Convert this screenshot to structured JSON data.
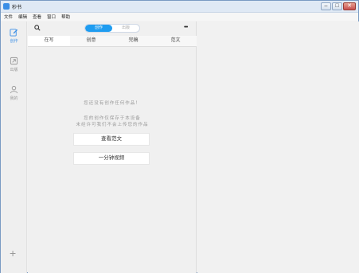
{
  "window": {
    "title": "秒书"
  },
  "menubar": {
    "items": [
      "文件",
      "编辑",
      "查看",
      "窗口",
      "帮助"
    ]
  },
  "sidebar": {
    "items": [
      {
        "label": "创作",
        "icon": "pencil-icon"
      },
      {
        "label": "出版",
        "icon": "publish-icon"
      },
      {
        "label": "我的",
        "icon": "user-icon"
      }
    ],
    "add_label": "+"
  },
  "toolbar": {
    "segments": [
      "创作",
      "出版"
    ],
    "more": "•••"
  },
  "tabs": [
    "在写",
    "创意",
    "完稿",
    "范文"
  ],
  "empty": {
    "line1": "您还没有创作任何作品！",
    "line2": "您的创作仅保存于本设备",
    "line3": "未经许可我们不会上传您的作品"
  },
  "buttons": {
    "view_samples": "查看范文",
    "one_minute_video": "一分钟视频"
  },
  "colors": {
    "accent": "#1e9cf0"
  }
}
